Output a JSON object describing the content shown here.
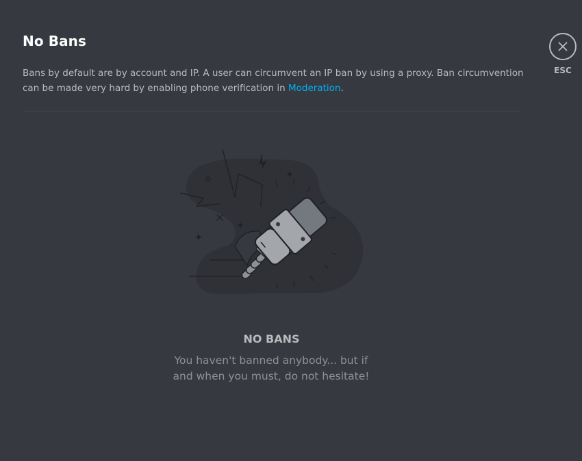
{
  "header": {
    "title": "No Bans",
    "description_prefix": "Bans by default are by account and IP. A user can circumvent an IP ban by using a proxy. Ban circumvention can be made very hard by enabling phone verification in ",
    "description_link": "Moderation",
    "description_suffix": "."
  },
  "close": {
    "label": "ESC",
    "icon": "close-icon"
  },
  "empty_state": {
    "illustration": "ban-hammer-illustration",
    "title": "NO BANS",
    "text": "You haven't banned anybody... but if and when you must, do not hesitate!"
  },
  "colors": {
    "background": "#36393f",
    "title": "#ffffff",
    "text_muted": "#b9bbbe",
    "link": "#00b0f4",
    "divider": "#42454a"
  }
}
